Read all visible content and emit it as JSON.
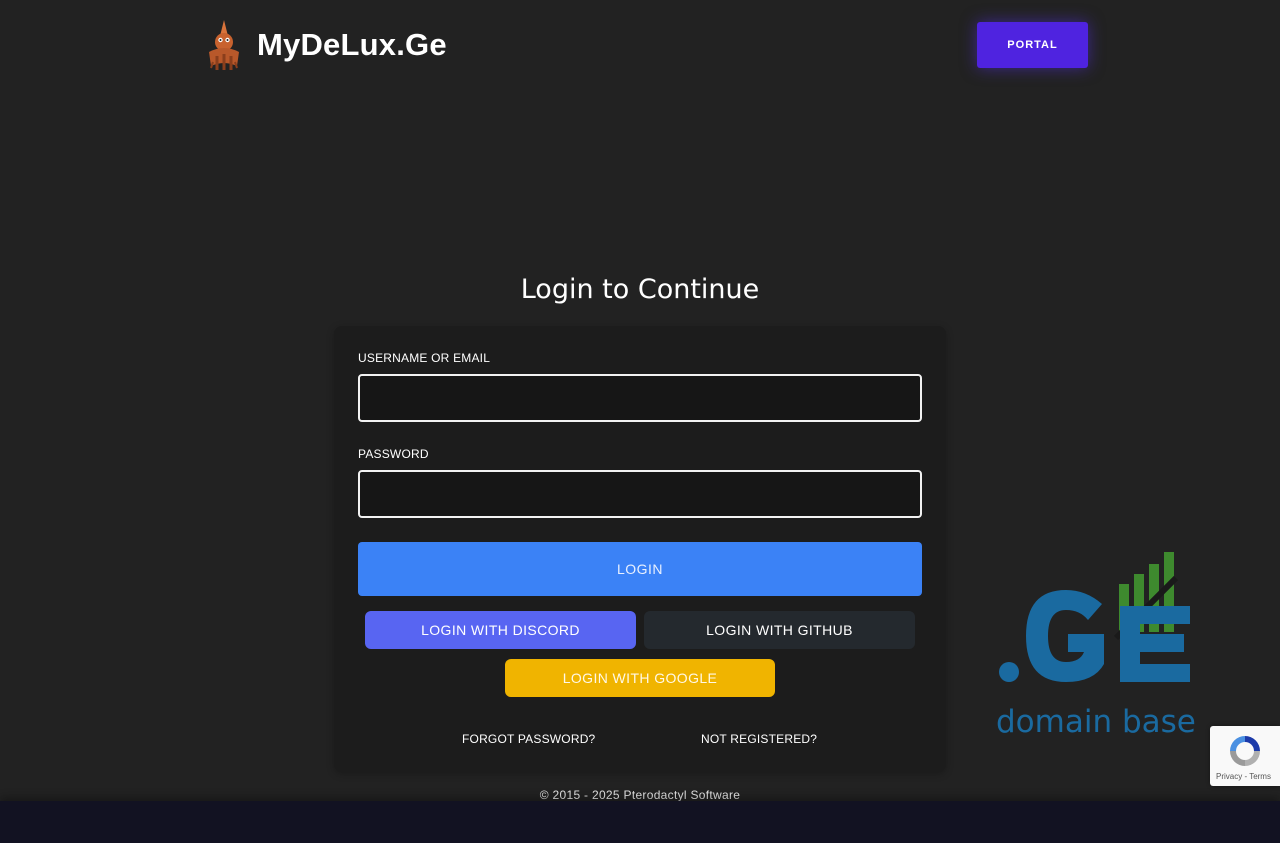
{
  "header": {
    "brand_name": "MyDeLux.Ge",
    "portal_label": "PORTAL"
  },
  "login": {
    "title": "Login to Continue",
    "username_label": "USERNAME OR EMAIL",
    "username_value": "",
    "password_label": "PASSWORD",
    "password_value": "",
    "submit_label": "LOGIN",
    "discord_label": "LOGIN WITH DISCORD",
    "github_label": "LOGIN WITH GITHUB",
    "google_label": "LOGIN WITH GOOGLE",
    "forgot_label": "FORGOT PASSWORD?",
    "register_label": "NOT REGISTERED?"
  },
  "footer": {
    "copyright": "© 2015 - 2025 Pterodactyl Software"
  },
  "badge": {
    "domain_text": "domain base",
    "recaptcha_links": "Privacy - Terms"
  },
  "colors": {
    "background": "#222222",
    "card": "#1c1c1c",
    "portal": "#4f23e0",
    "login": "#3b82f6",
    "discord": "#5865f2",
    "github": "#24292e",
    "google": "#f0b400"
  },
  "icons": {
    "brand": "pterodactyl-logo-icon",
    "recaptcha": "recaptcha-icon"
  }
}
